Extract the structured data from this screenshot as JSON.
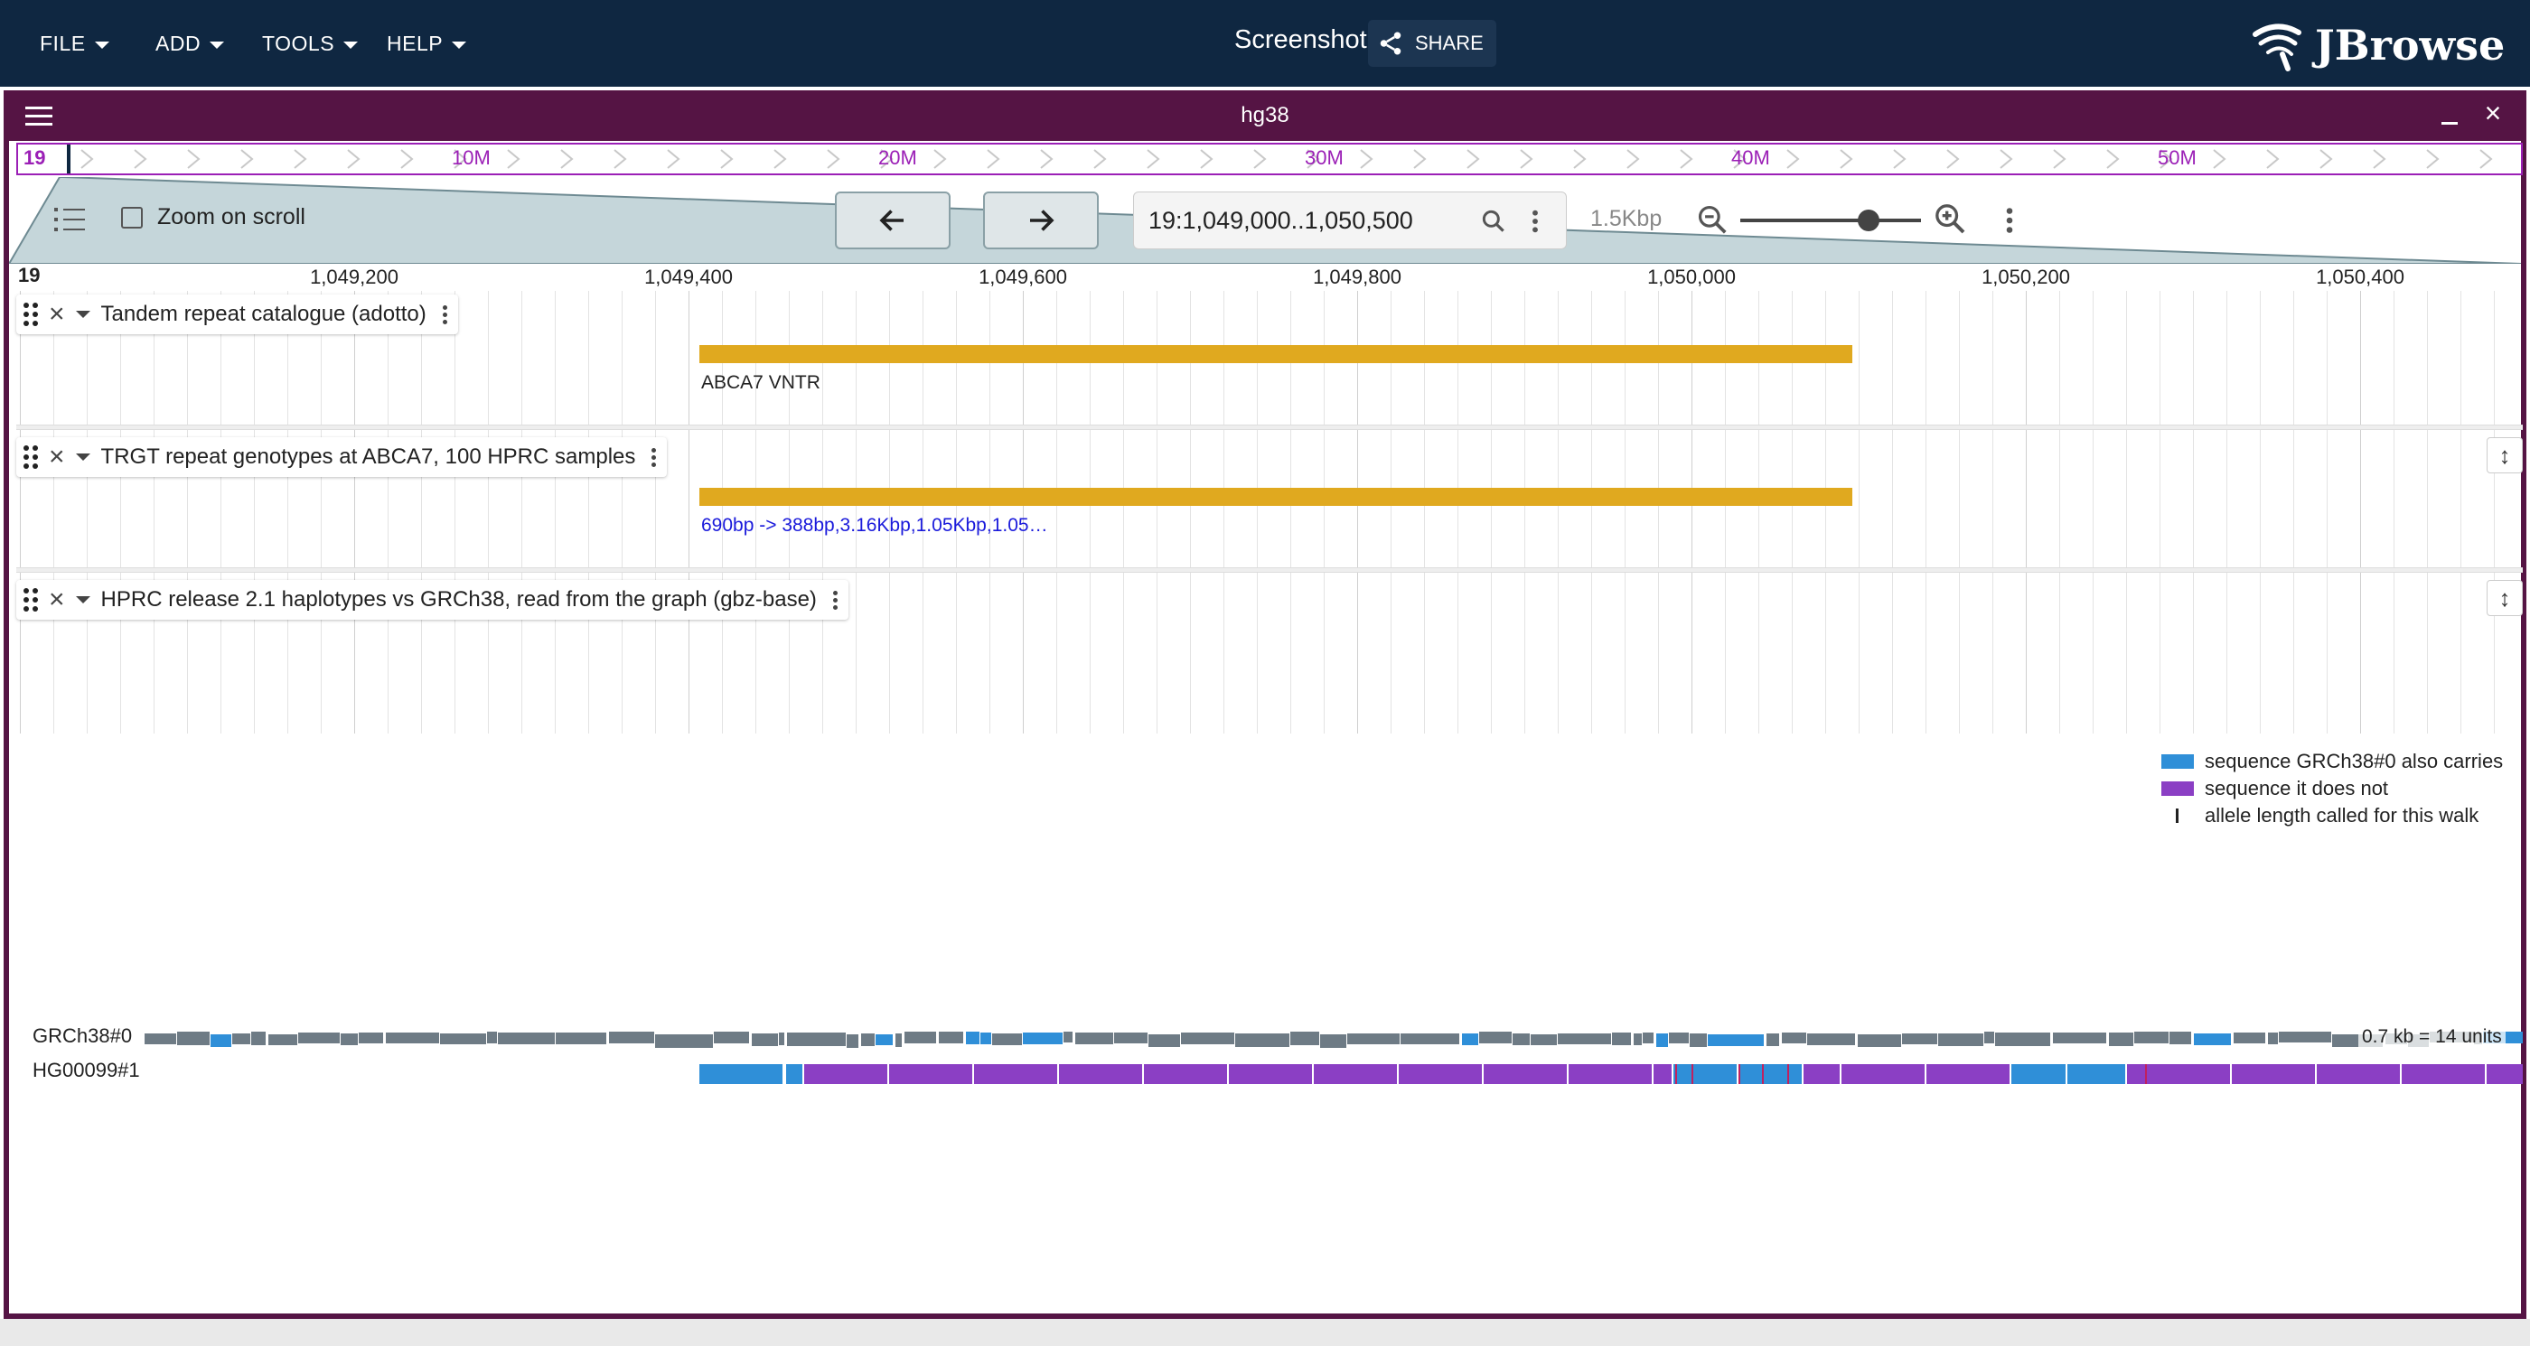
{
  "appbar": {
    "menus": [
      {
        "label": "FILE"
      },
      {
        "label": "ADD"
      },
      {
        "label": "TOOLS"
      },
      {
        "label": "HELP"
      }
    ],
    "session_name": "Screenshot",
    "share_label": "SHARE",
    "logo_text": "JBrowse"
  },
  "view": {
    "title": "hg38",
    "overview": {
      "chrom": "19",
      "ticks": [
        "10M",
        "20M",
        "30M",
        "40M",
        "50M"
      ]
    },
    "controls": {
      "zoom_on_scroll_label": "Zoom on scroll",
      "zoom_on_scroll_checked": false,
      "location": "19:1,049,000..1,050,500",
      "bp_label": "1.5Kbp",
      "zoom_level_fraction": 0.71
    },
    "ruler": {
      "chrom": "19",
      "labels": [
        "1,049,200",
        "1,049,400",
        "1,049,600",
        "1,049,800",
        "1,050,000",
        "1,050,200",
        "1,050,400"
      ]
    }
  },
  "tracks": [
    {
      "name": "Tandem repeat catalogue (adotto)",
      "feature_label": "ABCA7 VNTR",
      "feature_color": "#e0a91f"
    },
    {
      "name": "TRGT repeat genotypes at ABCA7, 100 HPRC samples",
      "feature_label": "690bp -> 388bp,3.16Kbp,1.05Kbp,1.05…",
      "feature_color": "#e0a91f",
      "label_color": "#1a1adb"
    },
    {
      "name": "HPRC release 2.1 haplotypes vs GRCh38, read from the graph (gbz-base)",
      "legend": [
        {
          "label": "sequence GRCh38#0 also carries",
          "color": "#2f8fd8"
        },
        {
          "label": "sequence it does not",
          "color": "#8b3fc4"
        },
        {
          "label": "allele length called for this walk"
        }
      ],
      "haplotypes": [
        {
          "name": "GRCh38#0"
        },
        {
          "name": "HG00099#1"
        }
      ],
      "units_label": "0.7 kb = 14 units"
    }
  ],
  "colors": {
    "appbar": "#0f2741",
    "view_header": "#551444",
    "overview_accent": "#9b1fb6",
    "carried": "#2f8fd8",
    "not_carried": "#8b3fc4",
    "reference_gray": "#6e7b85"
  }
}
